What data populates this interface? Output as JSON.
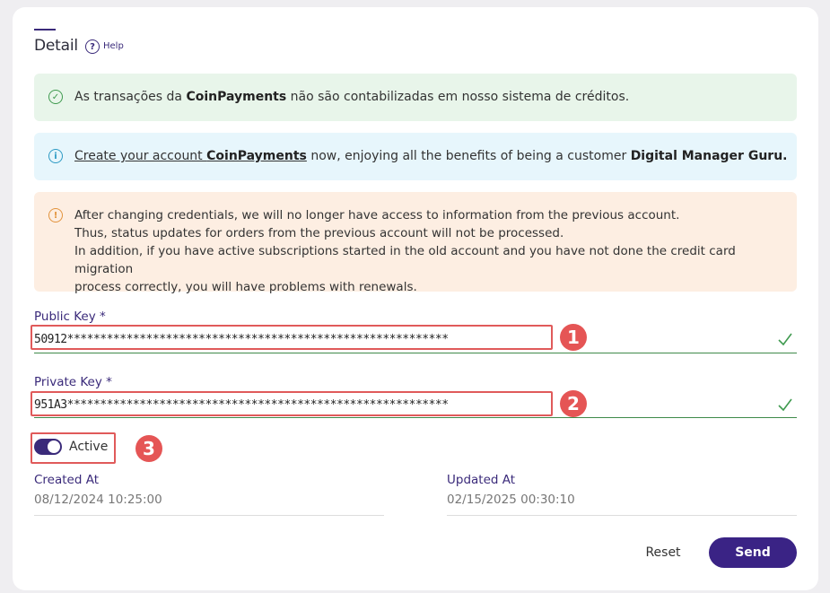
{
  "header": {
    "title": "Detail",
    "help_label": "Help",
    "help_icon": "question-circle-icon"
  },
  "alerts": {
    "success": {
      "icon": "check-circle-icon",
      "prefix": "As transações da ",
      "bold": "CoinPayments",
      "suffix": " não são contabilizadas em nosso sistema de créditos."
    },
    "info": {
      "icon": "info-circle-icon",
      "link_prefix": "Create your account ",
      "link_bold": "CoinPayments",
      "middle": " now, enjoying all the benefits of being a customer ",
      "bold": "Digital Manager Guru."
    },
    "warning": {
      "icon": "exclamation-circle-icon",
      "lines": [
        "After changing credentials, we will no longer have access to information from the previous account.",
        "Thus, status updates for orders from the previous account will not be processed.",
        "In addition, if you have active subscriptions started in the old account and you have not done the credit card migration",
        "process correctly, you will have problems with renewals."
      ]
    }
  },
  "fields": {
    "public_key": {
      "label": "Public Key *",
      "value": "50912**********************************************************",
      "badge": "1"
    },
    "private_key": {
      "label": "Private Key *",
      "value": "951A3**********************************************************",
      "badge": "2"
    }
  },
  "toggle": {
    "label": "Active",
    "checked": true,
    "badge": "3"
  },
  "meta": {
    "created_label": "Created At",
    "created_value": "08/12/2024 10:25:00",
    "updated_label": "Updated At",
    "updated_value": "02/15/2025 00:30:10"
  },
  "actions": {
    "reset_label": "Reset",
    "send_label": "Send"
  },
  "colors": {
    "brand": "#3a2385",
    "success": "#3f9a4f",
    "info": "#2d9ac4",
    "warning": "#e2933c",
    "highlight": "#e55555"
  }
}
